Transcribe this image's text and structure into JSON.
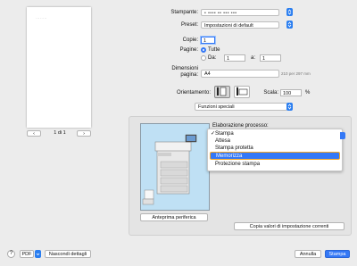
{
  "preview": {
    "page_text": "........",
    "page_indicator": "1 di 1",
    "prev_label": "‹",
    "next_label": "›",
    "prev_icon": "chevron-left-icon",
    "next_icon": "chevron-right-icon"
  },
  "printer": {
    "label": "Stampante:",
    "value": "▪ ▪▪▪▪ ▪▪ ▪▪▪ ▪▪▪"
  },
  "preset": {
    "label": "Preset:",
    "value": "Impostazioni di default"
  },
  "copies": {
    "label": "Copie:",
    "value": "1"
  },
  "pages": {
    "label": "Pagine:",
    "all_label": "Tutte",
    "from_label": "Da:",
    "from_value": "1",
    "to_label": "a:",
    "to_value": "1"
  },
  "paper_size": {
    "label_line1": "Dimensioni",
    "label_line2": "pagina:",
    "value": "A4",
    "dimensions": "210 per 297 mm"
  },
  "orientation": {
    "label": "Orientamento:",
    "portrait_icon": "portrait-orientation-icon",
    "landscape_icon": "landscape-orientation-icon"
  },
  "scale": {
    "label": "Scala:",
    "value": "100",
    "unit": "%"
  },
  "section_select": {
    "value": "Funzioni speciali"
  },
  "processing": {
    "label": "Elaborazione processo:",
    "options": [
      {
        "label": "Stampa",
        "checked": true
      },
      {
        "label": "Attesa",
        "checked": false
      },
      {
        "label": "Stampa protetta",
        "checked": false
      },
      {
        "label": "Memorizza",
        "checked": false,
        "highlighted": true
      },
      {
        "label": "Protezione stampa",
        "checked": false
      }
    ]
  },
  "device_preview_button": "Anteprima periferica",
  "copy_defaults_button": "Copia valori di impostazione correnti",
  "footer": {
    "help": "?",
    "pdf": "PDF",
    "hide_details": "Nascondi dettagli",
    "cancel": "Annulla",
    "print": "Stampa"
  },
  "colors": {
    "accent": "#3478f6",
    "highlight_border": "#f5a623"
  }
}
